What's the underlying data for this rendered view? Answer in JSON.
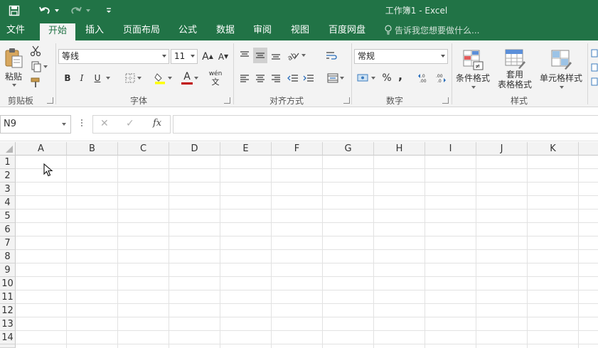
{
  "window": {
    "title": "工作簿1 - Excel"
  },
  "qat": {
    "save_icon": "save-icon",
    "undo_icon": "undo-icon",
    "redo_icon": "redo-icon",
    "customize_icon": "customize-qat-icon"
  },
  "menu": {
    "tabs": [
      {
        "label": "文件",
        "active": false
      },
      {
        "label": "开始",
        "active": true
      },
      {
        "label": "插入",
        "active": false
      },
      {
        "label": "页面布局",
        "active": false
      },
      {
        "label": "公式",
        "active": false
      },
      {
        "label": "数据",
        "active": false
      },
      {
        "label": "审阅",
        "active": false
      },
      {
        "label": "视图",
        "active": false
      },
      {
        "label": "百度网盘",
        "active": false
      }
    ],
    "tell_me": "告诉我您想要做什么..."
  },
  "ribbon": {
    "clipboard": {
      "group_label": "剪贴板",
      "paste_label": "粘贴"
    },
    "font": {
      "group_label": "字体",
      "font_name": "等线",
      "font_size": "11",
      "bold": "B",
      "italic": "I",
      "underline": "U",
      "grow": "A",
      "shrink": "A",
      "font_color": "A",
      "phonetic_top": "wén",
      "phonetic_bottom": "文"
    },
    "alignment": {
      "group_label": "对齐方式"
    },
    "number": {
      "group_label": "数字",
      "format": "常规",
      "percent": "%",
      "comma": ",",
      "inc_decimal": "←.0 .00",
      "dec_decimal": ".00 →.0"
    },
    "styles": {
      "group_label": "样式",
      "conditional": "条件格式",
      "table_line1": "套用",
      "table_line2": "表格格式",
      "cell_styles": "单元格样式"
    }
  },
  "formula_bar": {
    "name_box": "N9",
    "cancel": "✕",
    "enter": "✓",
    "fx": "fx",
    "content": ""
  },
  "sheet": {
    "columns": [
      "A",
      "B",
      "C",
      "D",
      "E",
      "F",
      "G",
      "H",
      "I",
      "J",
      "K"
    ],
    "rows": [
      "1",
      "2",
      "3",
      "4",
      "5",
      "6",
      "7",
      "8",
      "9",
      "10",
      "11",
      "12",
      "13",
      "14"
    ]
  },
  "colors": {
    "accent": "#217346",
    "ribbon_bg": "#f3f3f3",
    "fill_yellow": "#ffff00",
    "font_red": "#c00000"
  }
}
